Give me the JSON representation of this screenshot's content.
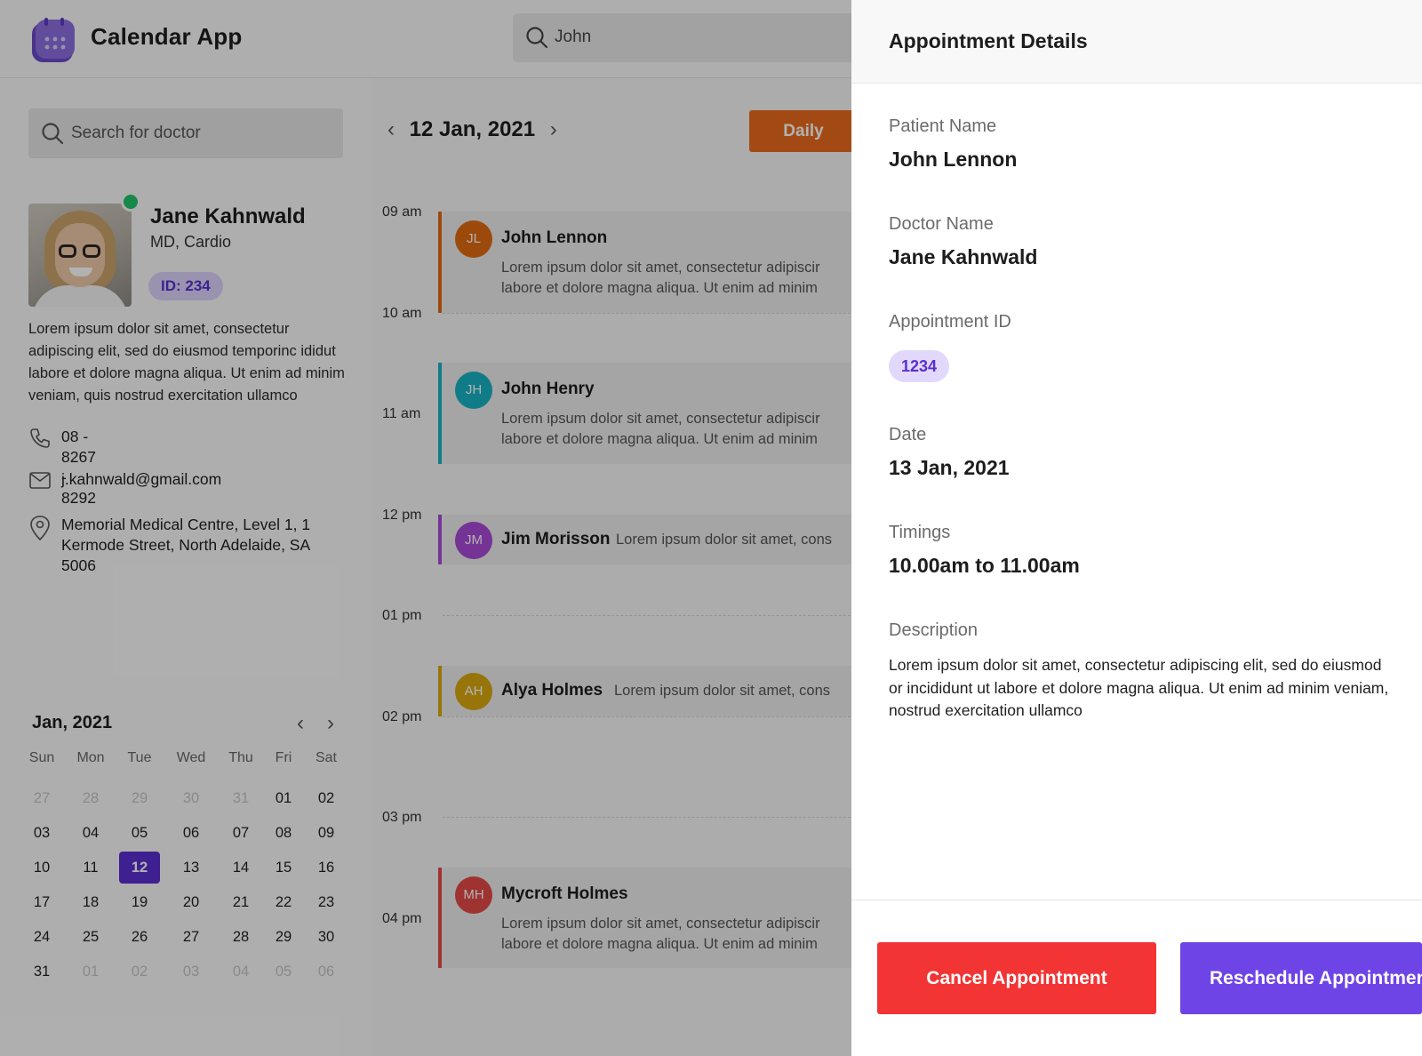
{
  "app": {
    "title": "Calendar App",
    "search_value": "John"
  },
  "doctor": {
    "search_placeholder": "Search for doctor",
    "name": "Jane Kahnwald",
    "specialty": "MD, Cardio",
    "id_badge": "ID: 234",
    "bio_lines": [
      "Lorem ipsum dolor sit amet, consectetur",
      "adipiscing elit, sed do eiusmod temporinc ididut",
      "labore et dolore magna aliqua. Ut enim ad minim",
      "veniam, quis nostrud exercitation ullamco"
    ],
    "phone": "08 - 8267 - 8292",
    "email": "j.kahnwald@gmail.com",
    "address_lines": [
      "Memorial Medical Centre, Level 1, 1",
      "Kermode Street, North Adelaide, SA",
      "5006"
    ]
  },
  "mini_calendar": {
    "title": "Jan, 2021",
    "weekdays": [
      "Sun",
      "Mon",
      "Tue",
      "Wed",
      "Thu",
      "Fri",
      "Sat"
    ],
    "weeks": [
      [
        "27",
        "28",
        "29",
        "30",
        "31",
        "01",
        "02"
      ],
      [
        "03",
        "04",
        "05",
        "06",
        "07",
        "08",
        "09"
      ],
      [
        "10",
        "11",
        "12",
        "13",
        "14",
        "15",
        "16"
      ],
      [
        "17",
        "18",
        "19",
        "20",
        "21",
        "22",
        "23"
      ],
      [
        "24",
        "25",
        "26",
        "27",
        "28",
        "29",
        "30"
      ],
      [
        "31",
        "01",
        "02",
        "03",
        "04",
        "05",
        "06"
      ]
    ],
    "selected": "12"
  },
  "schedule": {
    "date": "12 Jan, 2021",
    "view_label": "Daily",
    "time_labels": [
      "09 am",
      "10 am",
      "11 am",
      "12 pm",
      "01 pm",
      "02 pm",
      "03 pm",
      "04 pm"
    ],
    "appointments": [
      {
        "initials": "JL",
        "name": "John Lennon",
        "color": "#e06b12",
        "line1": "Lorem ipsum dolor sit amet, consectetur adipiscir",
        "line2": "labore et dolore magna aliqua. Ut enim ad minim"
      },
      {
        "initials": "JH",
        "name": "John Henry",
        "color": "#17b2c2",
        "line1": "Lorem ipsum dolor sit amet, consectetur adipiscir",
        "line2": "labore et dolore magna aliqua. Ut enim ad minim"
      },
      {
        "initials": "JM",
        "name": "Jim Morisson",
        "color": "#a64ad6",
        "inline": "Lorem ipsum dolor sit amet, cons"
      },
      {
        "initials": "AH",
        "name": "Alya Holmes",
        "color": "#d9a80f",
        "inline": "Lorem ipsum dolor sit amet, cons"
      },
      {
        "initials": "MH",
        "name": "Mycroft Holmes",
        "color": "#e44a48",
        "line1": "Lorem ipsum dolor sit amet, consectetur adipiscir",
        "line2": "labore et dolore magna aliqua. Ut enim ad minim"
      }
    ]
  },
  "details": {
    "title": "Appointment Details",
    "patient_label": "Patient Name",
    "patient": "John Lennon",
    "doctor_label": "Doctor Name",
    "doctor": "Jane Kahnwald",
    "appt_id_label": "Appointment ID",
    "appt_id": "1234",
    "date_label": "Date",
    "date": "13 Jan, 2021",
    "timings_label": "Timings",
    "timings": "10.00am to 11.00am",
    "description_label": "Description",
    "description_lines": [
      "Lorem ipsum dolor sit amet, consectetur adipiscing elit, sed do eiusmod",
      "or incididunt ut labore et dolore magna aliqua. Ut enim ad minim veniam,",
      "nostrud exercitation ullamco"
    ],
    "cancel_label": "Cancel Appointment",
    "reschedule_label": "Reschedule Appointment"
  }
}
